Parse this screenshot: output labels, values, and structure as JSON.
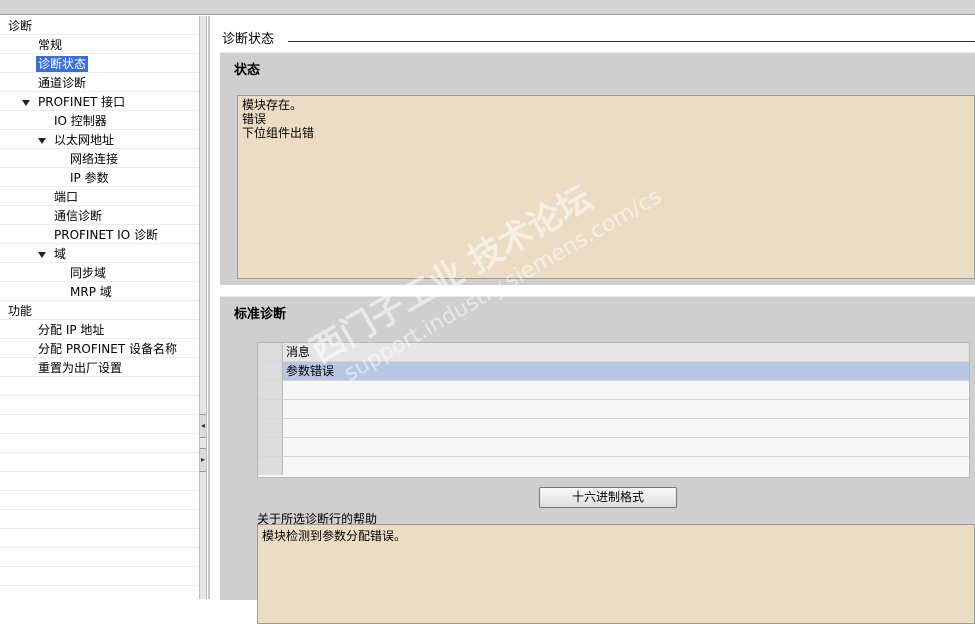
{
  "tree": [
    {
      "label": "诊断",
      "level": 0,
      "expanded": true,
      "selected": false
    },
    {
      "label": "常规",
      "level": 1,
      "expanded": false,
      "selected": false
    },
    {
      "label": "诊断状态",
      "level": 1,
      "expanded": false,
      "selected": true
    },
    {
      "label": "通道诊断",
      "level": 1,
      "expanded": false,
      "selected": false
    },
    {
      "label": "PROFINET 接口",
      "level": 1,
      "expanded": true,
      "selected": false
    },
    {
      "label": "IO 控制器",
      "level": 2,
      "expanded": false,
      "selected": false
    },
    {
      "label": "以太网地址",
      "level": 2,
      "expanded": true,
      "selected": false
    },
    {
      "label": "网络连接",
      "level": 3,
      "expanded": false,
      "selected": false
    },
    {
      "label": "IP 参数",
      "level": 3,
      "expanded": false,
      "selected": false
    },
    {
      "label": "端口",
      "level": 2,
      "expanded": false,
      "selected": false
    },
    {
      "label": "通信诊断",
      "level": 2,
      "expanded": false,
      "selected": false
    },
    {
      "label": "PROFINET IO 诊断",
      "level": 2,
      "expanded": false,
      "selected": false
    },
    {
      "label": "域",
      "level": 2,
      "expanded": true,
      "selected": false
    },
    {
      "label": "同步域",
      "level": 3,
      "expanded": false,
      "selected": false
    },
    {
      "label": "MRP 域",
      "level": 3,
      "expanded": false,
      "selected": false
    },
    {
      "label": "功能",
      "level": 0,
      "expanded": true,
      "selected": false
    },
    {
      "label": "分配 IP 地址",
      "level": 1,
      "expanded": false,
      "selected": false
    },
    {
      "label": "分配 PROFINET 设备名称",
      "level": 1,
      "expanded": false,
      "selected": false
    },
    {
      "label": "重置为出厂设置",
      "level": 1,
      "expanded": false,
      "selected": false
    }
  ],
  "page": {
    "title": "诊断状态"
  },
  "status": {
    "title": "状态",
    "lines": [
      "模块存在。",
      "错误",
      "下位组件出错"
    ]
  },
  "standard": {
    "title": "标准诊断",
    "column_header": "消息",
    "rows": [
      "参数错误",
      "",
      "",
      "",
      "",
      ""
    ],
    "selected_row": 0,
    "hex_button": "十六进制格式",
    "help_label": "关于所选诊断行的帮助",
    "help_text": "模块检测到参数分配错误。"
  },
  "watermark": {
    "line1": "西门子工业 技术论坛",
    "line2": "support.industry.siemens.com/cs"
  },
  "colors": {
    "selection": "#3a6fd8",
    "info_bg": "#ecdcc4",
    "section_bg": "#cfcfcf",
    "row_selected": "#b8c7e3"
  }
}
